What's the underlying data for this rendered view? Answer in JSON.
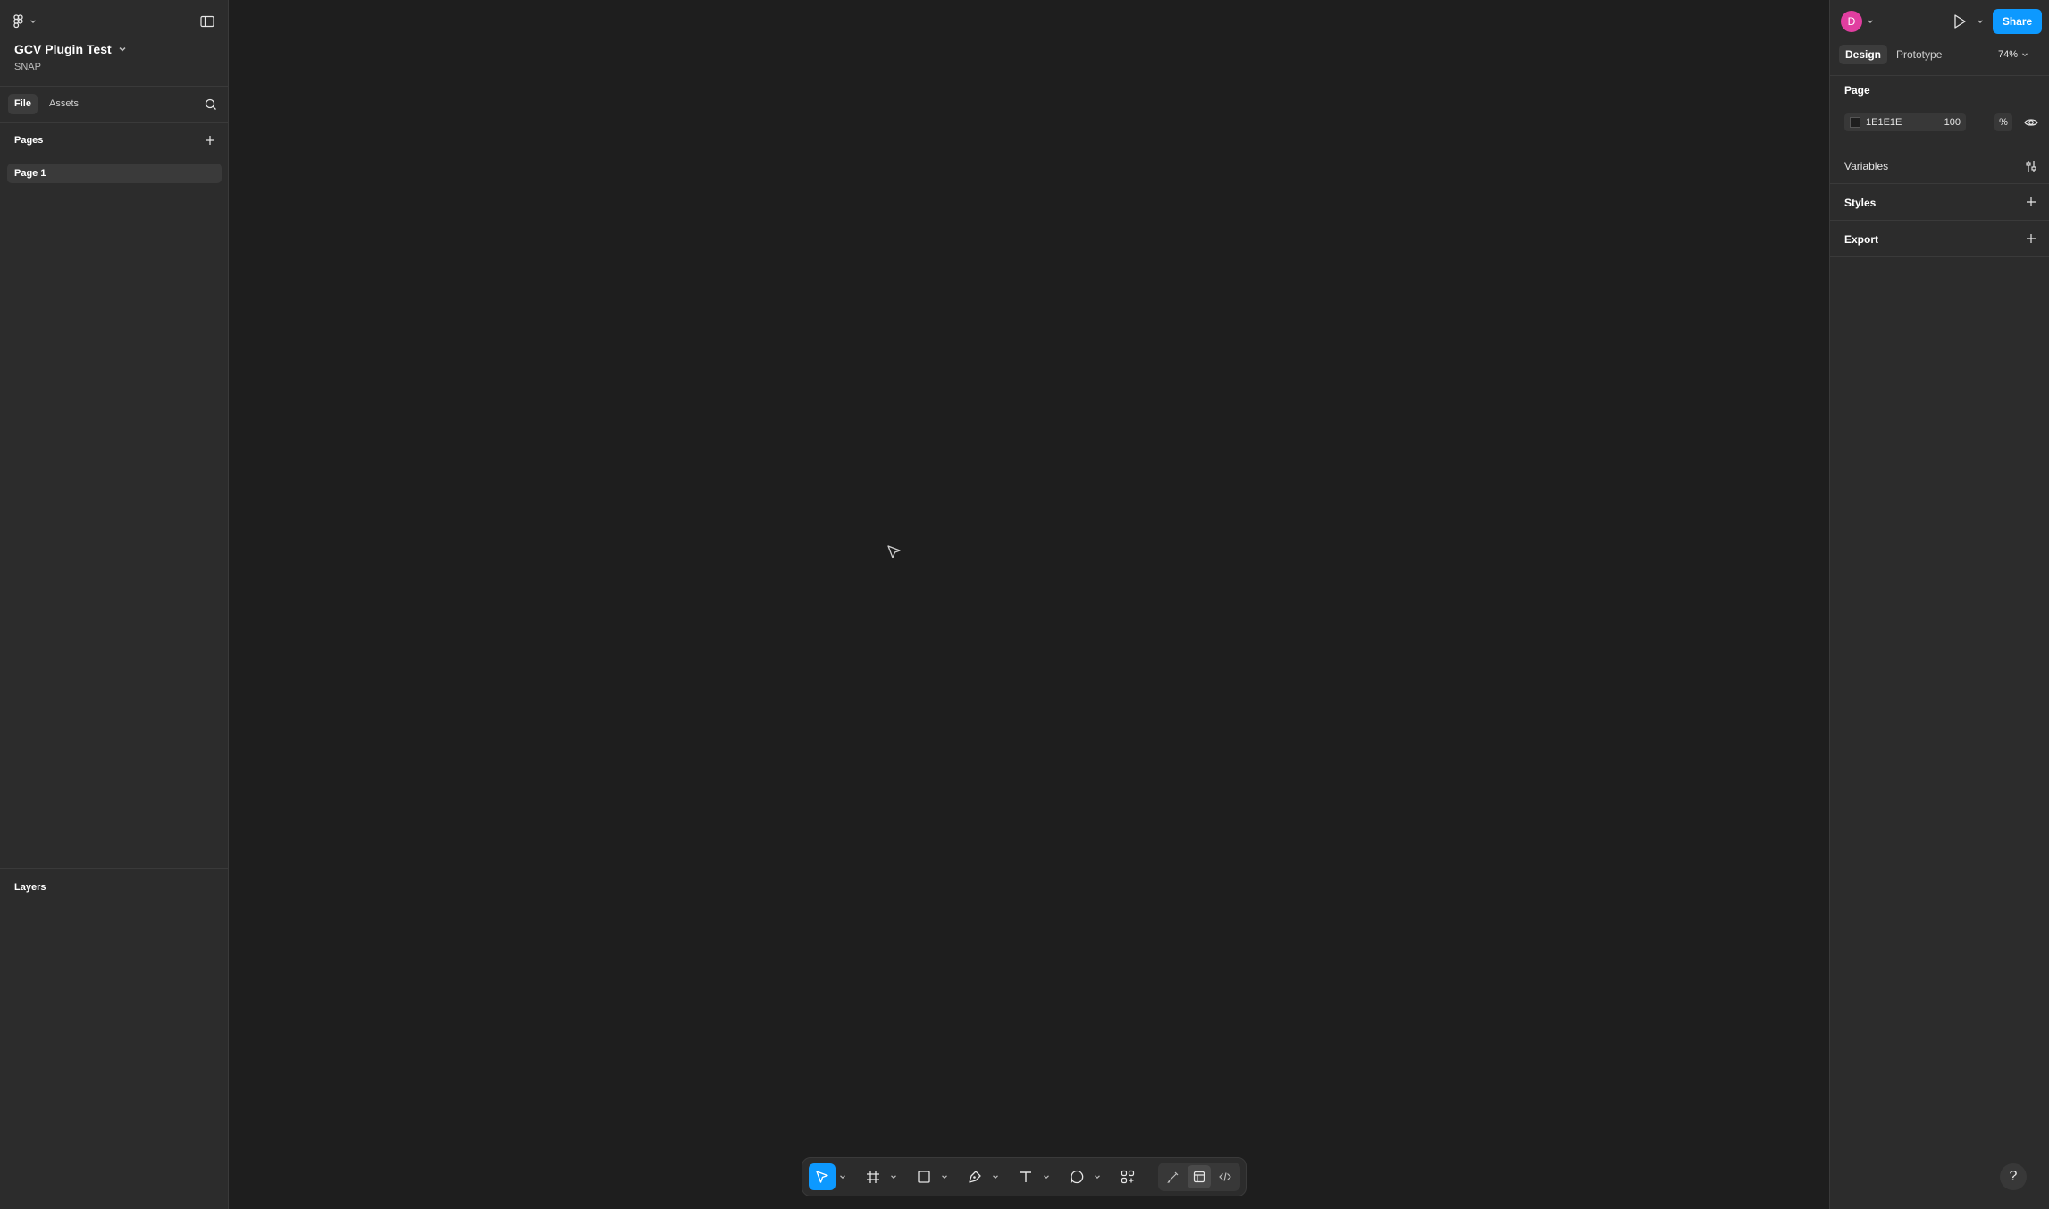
{
  "file": {
    "title": "GCV Plugin Test",
    "project": "SNAP"
  },
  "left_tabs": {
    "file": "File",
    "assets": "Assets"
  },
  "pages": {
    "title": "Pages",
    "items": [
      {
        "label": "Page 1"
      }
    ]
  },
  "layers": {
    "title": "Layers"
  },
  "header": {
    "avatar_initial": "D",
    "share_label": "Share"
  },
  "right_tabs": {
    "design": "Design",
    "prototype": "Prototype",
    "zoom": "74%"
  },
  "page_settings": {
    "title": "Page",
    "background_hex": "1E1E1E",
    "background_color": "#1e1e1e",
    "opacity": "100",
    "opacity_unit": "%"
  },
  "sections": {
    "variables": "Variables",
    "styles": "Styles",
    "export": "Export"
  },
  "help_label": "?",
  "colors": {
    "accent": "#0d99ff",
    "avatar": "#e13ea0",
    "canvas": "#1e1e1e",
    "panel": "#2c2c2c"
  },
  "toolbar": {
    "tools": [
      "move-tool",
      "frame-tool",
      "shape-tool",
      "pen-tool",
      "text-tool",
      "comment-tool",
      "actions-tool"
    ],
    "modes": [
      "draw-mode",
      "design-mode",
      "dev-mode"
    ]
  }
}
